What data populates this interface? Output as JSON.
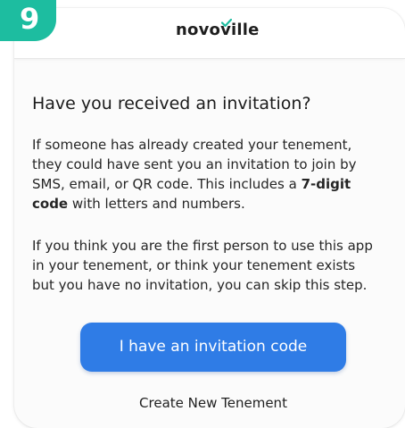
{
  "step_badge": {
    "number": "9",
    "color": "#1dbda0"
  },
  "header": {
    "logo_prefix": "novo",
    "logo_v": "v",
    "logo_suffix": "ille",
    "logo_check_icon": "checkmark-icon",
    "logo_check_color": "#1dbda0"
  },
  "content": {
    "title": "Have you received an invitation?",
    "paragraph_1_text": "If someone has already created your tenement,\nthey could have sent you an invitation to join by\nSMS, email, or QR code. This includes a ",
    "paragraph_1_bold": "7-digit\ncode",
    "paragraph_1_tail": " with letters and numbers.",
    "paragraph_2": "If you think you are the first person to use this app\nin your tenement, or think your tenement exists\nbut you have no invitation, you can skip this step."
  },
  "actions": {
    "primary_label": "I have an invitation code",
    "primary_color": "#2f7ce6",
    "secondary_label": "Create New Tenement"
  }
}
